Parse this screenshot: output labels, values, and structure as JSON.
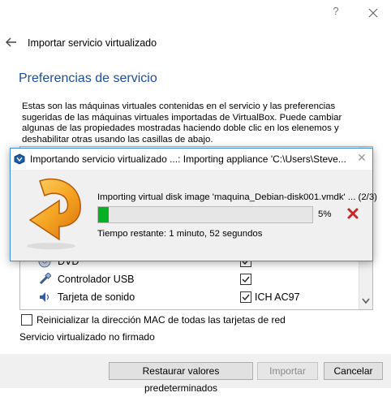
{
  "window": {
    "help_glyph": "?",
    "close_glyph": "✕",
    "back_icon": "back-arrow-icon",
    "title": "Importar servicio virtualizado"
  },
  "section": {
    "title": "Preferencias de servicio",
    "description": "Estas son las máquinas virtuales contenidas en el servicio y las preferencias sugeridas de las máquinas virtuales importadas de VirtualBox. Puede cambiar algunas de las propiedades mostradas haciendo doble clic en los elenemos y deshabilitar otras usando las casillas de abajo."
  },
  "settings_rows": [
    {
      "label": "DVD",
      "icon": "dvd-icon",
      "checked": true,
      "value": ""
    },
    {
      "label": "Controlador USB",
      "icon": "usb-icon",
      "checked": true,
      "value": ""
    },
    {
      "label": "Tarjeta de sonido",
      "icon": "sound-card-icon",
      "checked": true,
      "value": "ICH AC97"
    }
  ],
  "options": {
    "mac_label": "Reinicializar la dirección MAC de todas las tarjetas de red",
    "mac_checked": false,
    "unsigned_text": "Servicio virtualizado no firmado"
  },
  "buttons": {
    "restore": "Restaurar valores predeterminados",
    "import": "Importar",
    "cancel": "Cancelar"
  },
  "progress_dialog": {
    "title": "Importando servicio virtualizado ...: Importing appliance 'C:\\Users\\Steve...",
    "close_glyph": "✕",
    "operation": "Importing virtual disk image 'maquina_Debian-disk001.vmdk' ... (2/3)",
    "percent_label": "5%",
    "progress_fraction": 0.05,
    "remaining": "Tiempo restante: 1 minuto, 52 segundos"
  },
  "colors": {
    "accent_title": "#1f4e99",
    "progress_green": "#06b025",
    "dialog_border": "#3c8ed6",
    "cancel_red": "#c62828"
  }
}
